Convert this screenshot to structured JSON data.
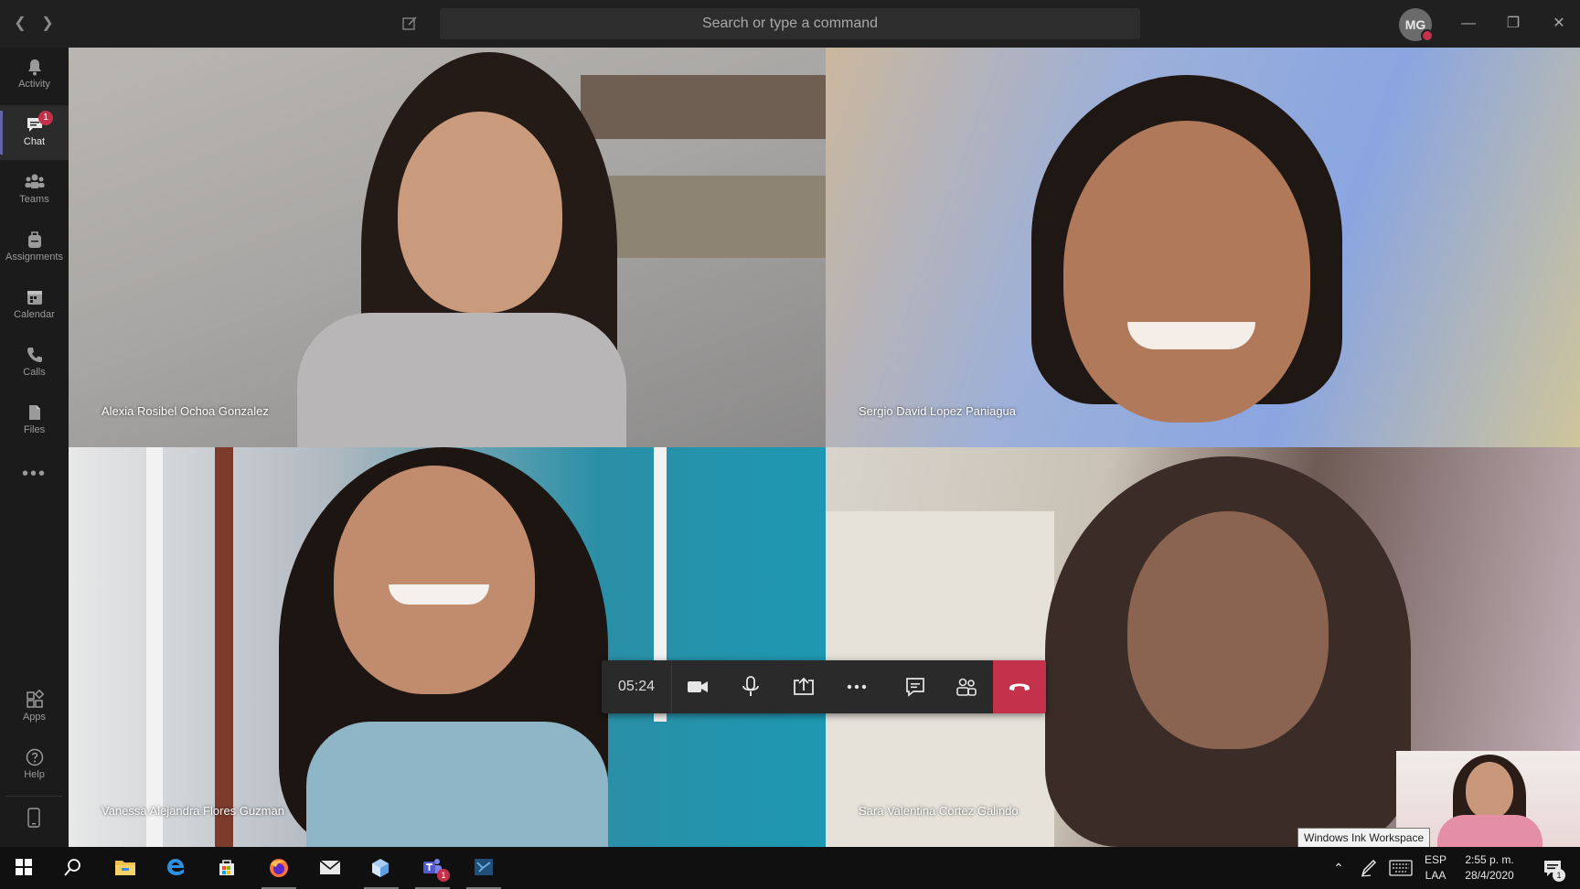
{
  "titlebar": {
    "search_placeholder": "Search or type a command",
    "avatar_initials": "MG"
  },
  "rail": {
    "items": [
      {
        "label": "Activity"
      },
      {
        "label": "Chat",
        "badge": "1"
      },
      {
        "label": "Teams"
      },
      {
        "label": "Assignments"
      },
      {
        "label": "Calendar"
      },
      {
        "label": "Calls"
      },
      {
        "label": "Files"
      },
      {
        "label": "Apps"
      },
      {
        "label": "Help"
      }
    ],
    "more": "•••"
  },
  "participants": [
    {
      "name": "Alexia Rosibel Ochoa Gonzalez"
    },
    {
      "name": "Sergio David Lopez Paniagua"
    },
    {
      "name": "Vanessa Alejandra Flores Guzman"
    },
    {
      "name": "Sara Valentina Cortez Galindo"
    }
  ],
  "call_controls": {
    "timer": "05:24",
    "buttons": [
      "video-camera-icon",
      "microphone-icon",
      "share-screen-icon",
      "more-options-icon",
      "chat-icon",
      "participants-icon",
      "hang-up-icon"
    ]
  },
  "tooltip": "Windows Ink Workspace",
  "taskbar": {
    "apps": [
      "windows-start-icon",
      "search-icon",
      "file-explorer-icon",
      "edge-icon",
      "store-icon",
      "firefox-icon",
      "mail-icon",
      "3d-viewer-icon",
      "teams-icon",
      "vm-icon"
    ],
    "teams_badge": "1",
    "language_top": "ESP",
    "language_bottom": "LAA",
    "time": "2:55 p. m.",
    "date": "28/4/2020",
    "notification_count": "1"
  },
  "colors": {
    "accent": "#6264a7",
    "hangup": "#c4314b",
    "titlebar": "#202020",
    "rail": "#1b1b1b"
  }
}
